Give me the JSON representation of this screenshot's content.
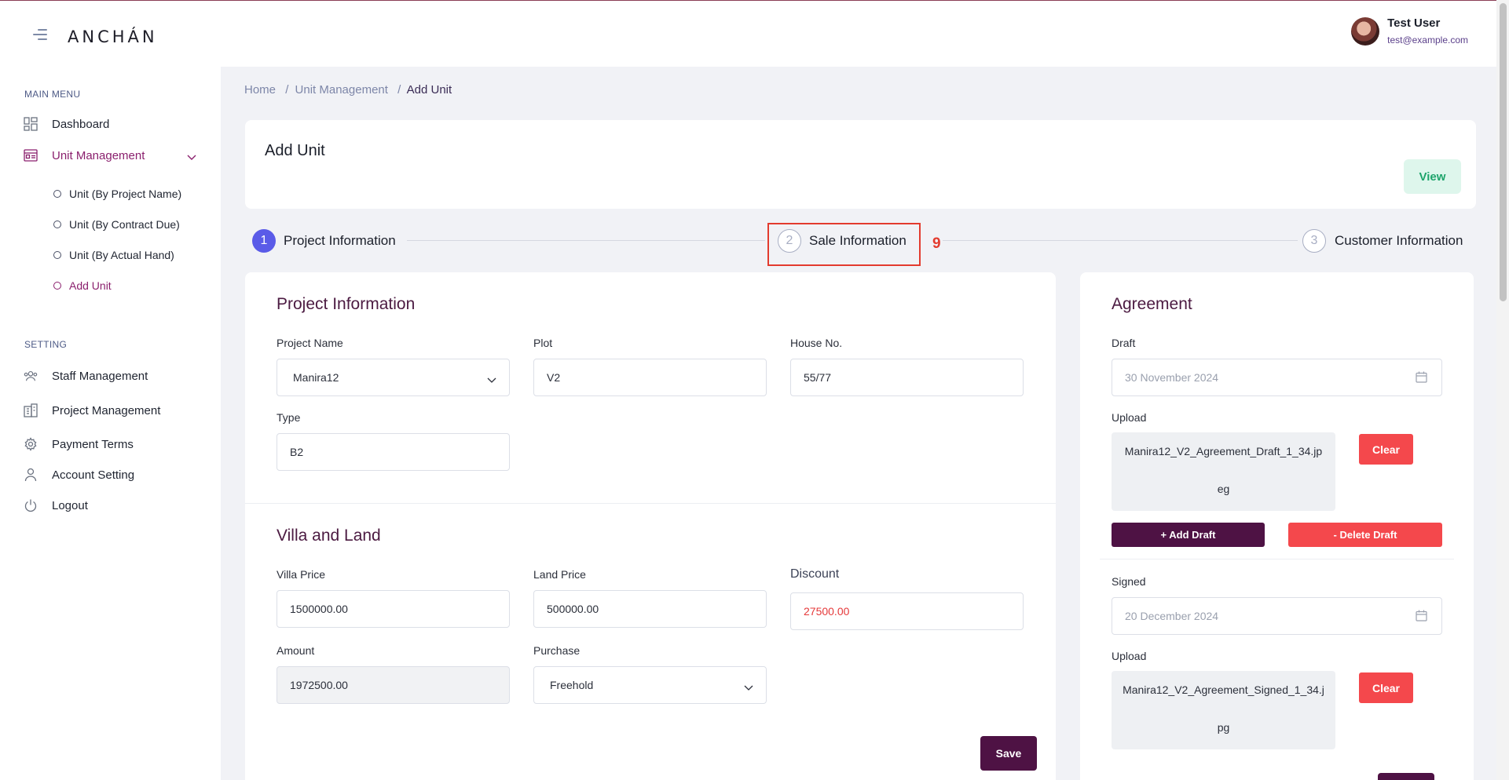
{
  "app": {
    "logo": "ANCHÁN"
  },
  "user": {
    "name": "Test User",
    "email": "test@example.com"
  },
  "sidebar": {
    "main_menu_label": "MAIN MENU",
    "setting_label": "SETTING",
    "items": [
      {
        "label": "Dashboard"
      },
      {
        "label": "Unit Management"
      }
    ],
    "unit_sub_items": [
      {
        "label": "Unit (By Project Name)"
      },
      {
        "label": "Unit (By Contract Due)"
      },
      {
        "label": "Unit (By Actual Hand)"
      },
      {
        "label": "Add Unit"
      }
    ],
    "setting_items": [
      {
        "label": "Staff Management"
      },
      {
        "label": "Project Management"
      },
      {
        "label": "Payment Terms"
      },
      {
        "label": "Account Setting"
      },
      {
        "label": "Logout"
      }
    ]
  },
  "breadcrumb": {
    "home": "Home",
    "unit_management": "Unit Management",
    "current": "Add Unit",
    "sep": "/"
  },
  "header": {
    "title": "Add Unit",
    "view_button": "View"
  },
  "stepper": {
    "steps": [
      {
        "num": "1",
        "label": "Project Information",
        "status": "active"
      },
      {
        "num": "2",
        "label": "Sale Information",
        "status": "pending"
      },
      {
        "num": "3",
        "label": "Customer Information",
        "status": "pending"
      }
    ],
    "highlight_marker": "9"
  },
  "project_info": {
    "title": "Project Information",
    "project_name_label": "Project Name",
    "project_name_value": "Manira12",
    "plot_label": "Plot",
    "plot_value": "V2",
    "house_no_label": "House No.",
    "house_no_value": "55/77",
    "type_label": "Type",
    "type_value": "B2"
  },
  "villa_land": {
    "title": "Villa and Land",
    "villa_price_label": "Villa Price",
    "villa_price_value": "1500000.00",
    "land_price_label": "Land Price",
    "land_price_value": "500000.00",
    "discount_label": "Discount",
    "discount_value": "27500.00",
    "amount_label": "Amount",
    "amount_value": "1972500.00",
    "purchase_label": "Purchase",
    "purchase_value": "Freehold",
    "save_button": "Save"
  },
  "agreement": {
    "title": "Agreement",
    "draft_label": "Draft",
    "draft_date": "30 November 2024",
    "upload_label": "Upload",
    "draft_file": "Manira12_V2_Agreement_Draft_1_34.jpeg",
    "clear_button": "Clear",
    "add_draft_button": "+ Add Draft",
    "delete_draft_button": "- Delete Draft",
    "signed_label": "Signed",
    "signed_date": "20 December 2024",
    "signed_upload_label": "Upload",
    "signed_file": "Manira12_V2_Agreement_Signed_1_34.jpg",
    "signed_clear_button": "Clear"
  },
  "colors": {
    "brand": "#4e1244",
    "accent_active": "#8a1f6d",
    "stepper_active": "#5a5be8",
    "danger": "#f4484c",
    "view_btn_bg": "#def6ec",
    "view_btn_text": "#1ea46b",
    "marker": "#e33b2e"
  }
}
